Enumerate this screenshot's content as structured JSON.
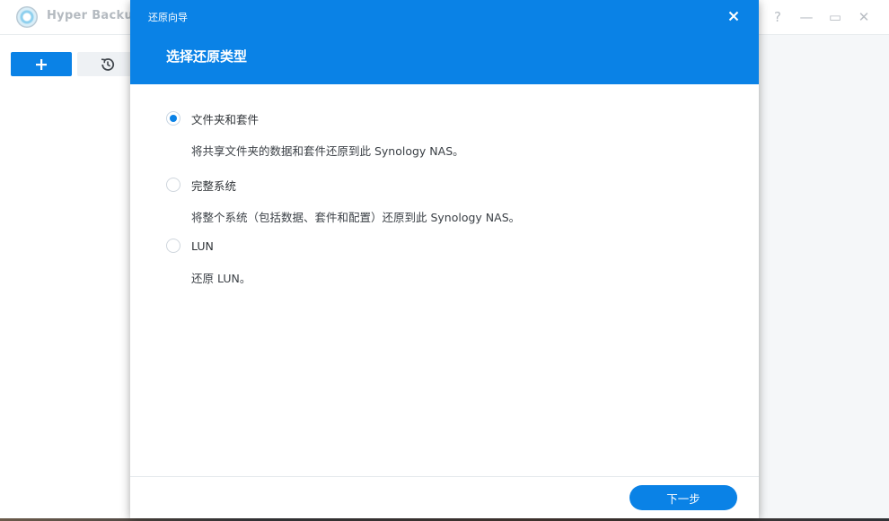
{
  "app": {
    "title": "Hyper Backup",
    "controls": {
      "help": "?",
      "minimize": "—",
      "maximize": "▭",
      "close": "✕"
    }
  },
  "toolbar": {
    "add_label": "+",
    "restore_icon": "history-icon"
  },
  "dialog": {
    "title": "还原向导",
    "heading": "选择还原类型",
    "options": [
      {
        "label": "文件夹和套件",
        "description": "将共享文件夹的数据和套件还原到此 Synology NAS。",
        "checked": true
      },
      {
        "label": "完整系统",
        "description": "将整个系统（包括数据、套件和配置）还原到此 Synology NAS。",
        "checked": false
      },
      {
        "label": "LUN",
        "description": "还原 LUN。",
        "checked": false
      }
    ],
    "next_label": "下一步"
  },
  "colors": {
    "accent": "#0a82e6",
    "header_text": "#ffffff",
    "muted": "#b4bac0"
  }
}
